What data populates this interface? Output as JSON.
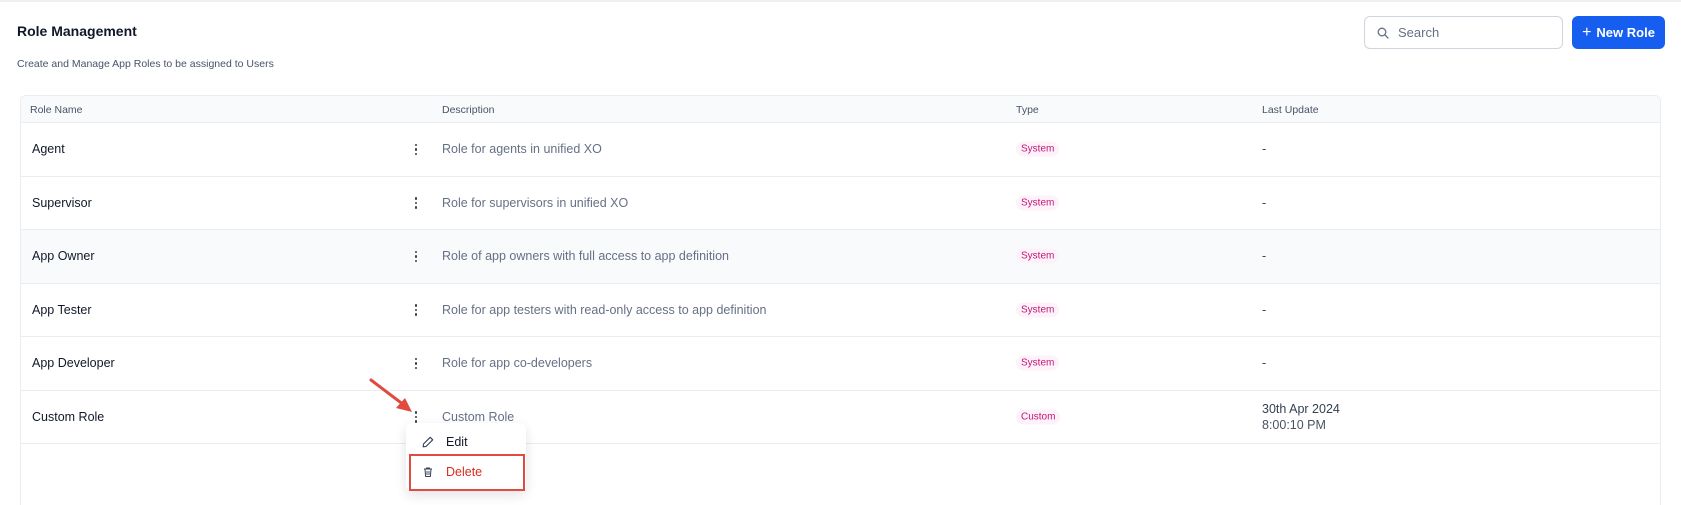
{
  "header": {
    "title": "Role Management",
    "subtitle": "Create and Manage App Roles to be assigned to Users",
    "search_placeholder": "Search",
    "new_role_label": "New Role"
  },
  "table": {
    "columns": [
      "Role Name",
      "Description",
      "Type",
      "Last Update"
    ],
    "rows": [
      {
        "name": "Agent",
        "description": "Role for agents in unified XO",
        "type": "System",
        "last_update": "-",
        "last_update_time": ""
      },
      {
        "name": "Supervisor",
        "description": "Role for supervisors in unified XO",
        "type": "System",
        "last_update": "-",
        "last_update_time": ""
      },
      {
        "name": "App Owner",
        "description": "Role of app owners with full access to app definition",
        "type": "System",
        "last_update": "-",
        "last_update_time": ""
      },
      {
        "name": "App Tester",
        "description": "Role for app testers with read-only access to app definition",
        "type": "System",
        "last_update": "-",
        "last_update_time": ""
      },
      {
        "name": "App Developer",
        "description": "Role for app co-developers",
        "type": "System",
        "last_update": "-",
        "last_update_time": ""
      },
      {
        "name": "Custom Role",
        "description": "Custom Role",
        "type": "Custom",
        "last_update": "30th Apr 2024",
        "last_update_time": "8:00:10 PM"
      }
    ]
  },
  "context_menu": {
    "edit_label": "Edit",
    "delete_label": "Delete"
  },
  "colors": {
    "primary": "#155eef",
    "badge_bg": "#fdf2fa",
    "badge_text": "#c11574",
    "danger": "#d92d20",
    "annotation": "#e04a3f"
  }
}
